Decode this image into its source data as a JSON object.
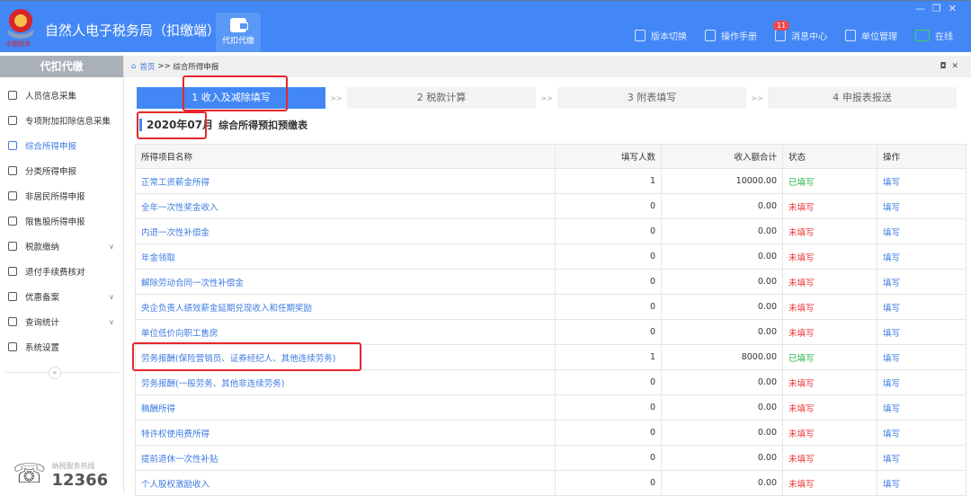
{
  "header": {
    "app_title": "自然人电子税务局（扣缴端）",
    "logo_text": "中国税务",
    "tab_label": "代扣代缴",
    "tools": [
      {
        "icon": "document-icon",
        "label": "版本切换"
      },
      {
        "icon": "manual-icon",
        "label": "操作手册"
      },
      {
        "icon": "mail-icon",
        "label": "消息中心",
        "badge": "11"
      },
      {
        "icon": "building-icon",
        "label": "单位管理"
      },
      {
        "icon": "monitor-icon",
        "label": "在线"
      }
    ]
  },
  "sidebar": {
    "title": "代扣代缴",
    "items": [
      {
        "label": "人员信息采集",
        "icon": "person-icon"
      },
      {
        "label": "专项附加扣除信息采集",
        "icon": "list-icon"
      },
      {
        "label": "综合所得申报",
        "icon": "layers-icon",
        "active": true
      },
      {
        "label": "分类所得申报",
        "icon": "pie-icon"
      },
      {
        "label": "非居民所得申报",
        "icon": "user-icon"
      },
      {
        "label": "限售股所得申报",
        "icon": "bar-chart-icon"
      },
      {
        "label": "税款缴纳",
        "icon": "folder-icon",
        "expand": true
      },
      {
        "label": "退付手续费核对",
        "icon": "doc-icon"
      },
      {
        "label": "优惠备案",
        "icon": "copy-icon",
        "expand": true
      },
      {
        "label": "查询统计",
        "icon": "search-list-icon",
        "expand": true
      },
      {
        "label": "系统设置",
        "icon": "gear-icon"
      }
    ],
    "collapse": "«",
    "hotline_label": "纳税服务热线",
    "hotline_number": "12366"
  },
  "breadcrumb": {
    "home": "首页",
    "sep": ">>",
    "current": "综合所得申报"
  },
  "steps": [
    {
      "label": "1 收入及减除填写",
      "active": true
    },
    {
      "label": "2 税款计算"
    },
    {
      "label": "3 附表填写"
    },
    {
      "label": "4 申报表报送"
    }
  ],
  "step_sep": ">>",
  "form": {
    "period": "2020年07月",
    "title": "综合所得预扣预缴表"
  },
  "table": {
    "headers": [
      "所得项目名称",
      "填写人数",
      "收入额合计",
      "状态",
      "操作"
    ],
    "rows": [
      [
        "正常工资薪金所得",
        "1",
        "10000.00",
        "已填写",
        "填写"
      ],
      [
        "全年一次性奖金收入",
        "0",
        "0.00",
        "未填写",
        "填写"
      ],
      [
        "内退一次性补偿金",
        "0",
        "0.00",
        "未填写",
        "填写"
      ],
      [
        "年金领取",
        "0",
        "0.00",
        "未填写",
        "填写"
      ],
      [
        "解除劳动合同一次性补偿金",
        "0",
        "0.00",
        "未填写",
        "填写"
      ],
      [
        "央企负责人绩效薪金延期兑现收入和任期奖励",
        "0",
        "0.00",
        "未填写",
        "填写"
      ],
      [
        "单位低价向职工售房",
        "0",
        "0.00",
        "未填写",
        "填写"
      ],
      [
        "劳务报酬(保险营销员、证券经纪人、其他连续劳务)",
        "1",
        "8000.00",
        "已填写",
        "填写"
      ],
      [
        "劳务报酬(一般劳务、其他非连续劳务)",
        "0",
        "0.00",
        "未填写",
        "填写"
      ],
      [
        "稿酬所得",
        "0",
        "0.00",
        "未填写",
        "填写"
      ],
      [
        "特许权使用费所得",
        "0",
        "0.00",
        "未填写",
        "填写"
      ],
      [
        "提前退休一次性补贴",
        "0",
        "0.00",
        "未填写",
        "填写"
      ],
      [
        "个人股权激励收入",
        "0",
        "0.00",
        "未填写",
        "填写"
      ]
    ]
  }
}
